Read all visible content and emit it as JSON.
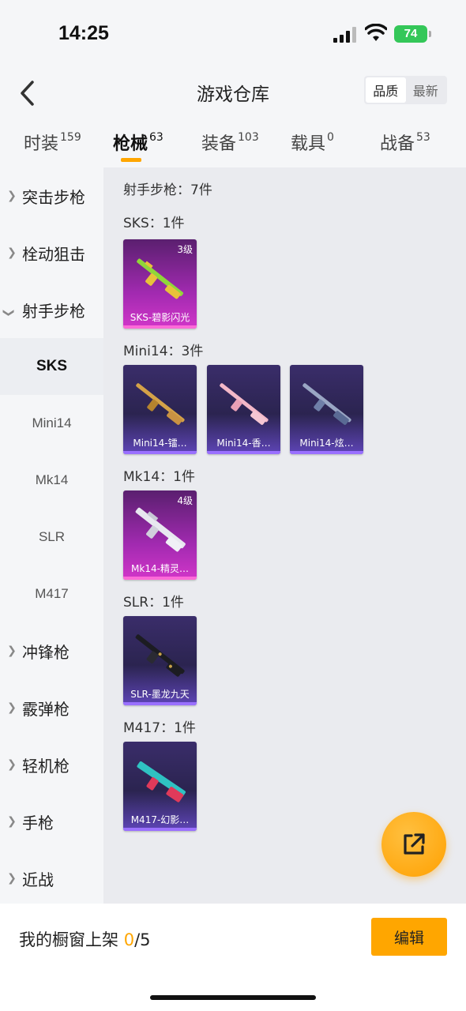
{
  "status_bar": {
    "time": "14:25",
    "battery": "74"
  },
  "header": {
    "title": "游戏仓库",
    "sort_options": [
      "品质",
      "最新"
    ]
  },
  "tabs": [
    {
      "label": "时装",
      "count": "159"
    },
    {
      "label": "枪械",
      "count": "63"
    },
    {
      "label": "装备",
      "count": "103"
    },
    {
      "label": "载具",
      "count": "0"
    },
    {
      "label": "战备",
      "count": "53"
    }
  ],
  "sidebar": {
    "categories": [
      "突击步枪",
      "栓动狙击",
      "射手步枪",
      "冲锋枪",
      "霰弹枪",
      "轻机枪",
      "手枪",
      "近战"
    ],
    "subitems": [
      "SKS",
      "Mini14",
      "Mk14",
      "SLR",
      "M417"
    ]
  },
  "content": {
    "summary": "射手步枪：7件",
    "sections": [
      {
        "label": "SKS：1件",
        "items": [
          {
            "name": "SKS-碧影闪光",
            "level": "3级"
          }
        ]
      },
      {
        "label": "Mini14：3件",
        "items": [
          {
            "name": "Mini14-镭…"
          },
          {
            "name": "Mini14-香…"
          },
          {
            "name": "Mini14-炫…"
          }
        ]
      },
      {
        "label": "Mk14：1件",
        "items": [
          {
            "name": "Mk14-精灵…",
            "level": "4级"
          }
        ]
      },
      {
        "label": "SLR：1件",
        "items": [
          {
            "name": "SLR-墨龙九天"
          }
        ]
      },
      {
        "label": "M417：1件",
        "items": [
          {
            "name": "M417-幻影…"
          }
        ]
      }
    ]
  },
  "bottom": {
    "showcase_label": "我的橱窗上架 ",
    "count_current": "0",
    "count_total": "/5",
    "edit_label": "编辑"
  },
  "colors": {
    "accent": "#ffa600",
    "purple_card": "#2b2450",
    "magenta_card": "#a12ab0"
  },
  "icons": {
    "back": "chevron-left-icon",
    "share": "external-link-icon",
    "expand": "chevron-right-icon",
    "collapse": "chevron-down-icon"
  }
}
